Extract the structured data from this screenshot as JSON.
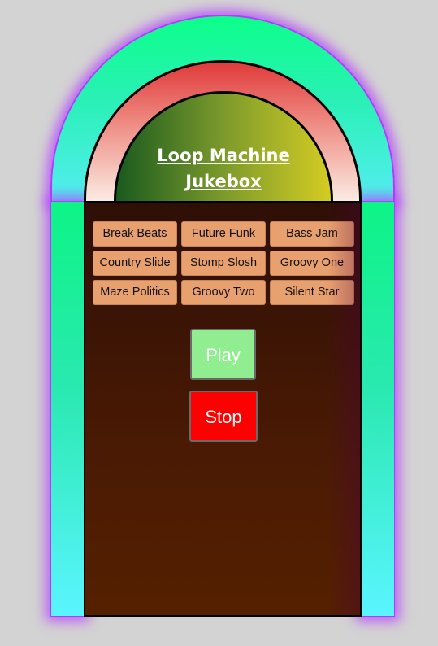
{
  "jukebox": {
    "title": "Loop Machine\nJukebox",
    "songs": [
      "Break Beats",
      "Future Funk",
      "Bass Jam",
      "Country Slide",
      "Stomp Slosh",
      "Groovy One",
      "Maze Politics",
      "Groovy Two",
      "Silent Star"
    ],
    "controls": {
      "play_label": "Play",
      "stop_label": "Stop"
    }
  },
  "colors": {
    "background": "#d3d3d3",
    "neon_glow": "#b13cff",
    "neon_green": "#0cff8a",
    "neon_cyan": "#55eef2",
    "song_button": "#e9a06f",
    "play_button": "#90ee90",
    "stop_button": "#ff0000",
    "cabinet": "#4a1a04"
  }
}
